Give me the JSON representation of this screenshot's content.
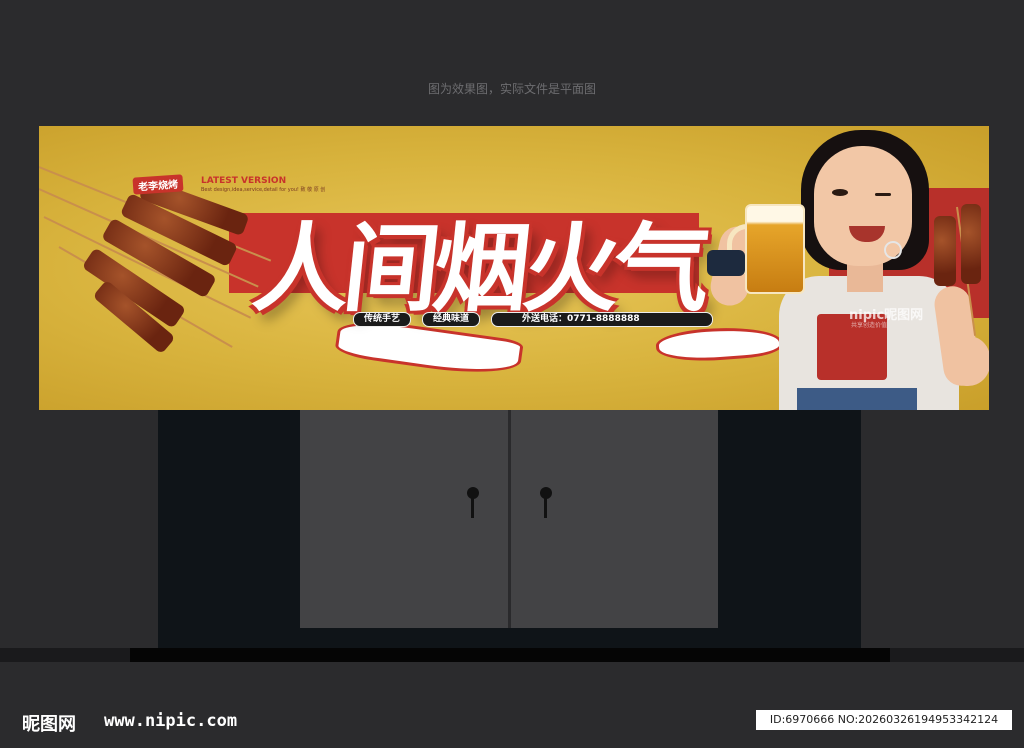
{
  "caption": "图为效果图，实际文件是平面图",
  "banner": {
    "headline": "人间烟火气",
    "brand_badge": "老李烧烤",
    "latest": "LATEST VERSION",
    "tagline": "Best design,idea,service,detail for you! 致 敬 原 创",
    "pills": [
      "传统手艺",
      "经典味道",
      "外送电话：0771-8888888"
    ],
    "watermark": "nipic昵图网",
    "watermark_sub": "共享创造价值"
  },
  "footer": {
    "logo": "昵图网",
    "site": "www.nipic.com",
    "id_line": "ID:6970666 NO:20260326194953342124"
  },
  "colors": {
    "accent_red": "#c8332b",
    "banner_yellow": "#d8b33d",
    "background": "#2b2b2d"
  }
}
